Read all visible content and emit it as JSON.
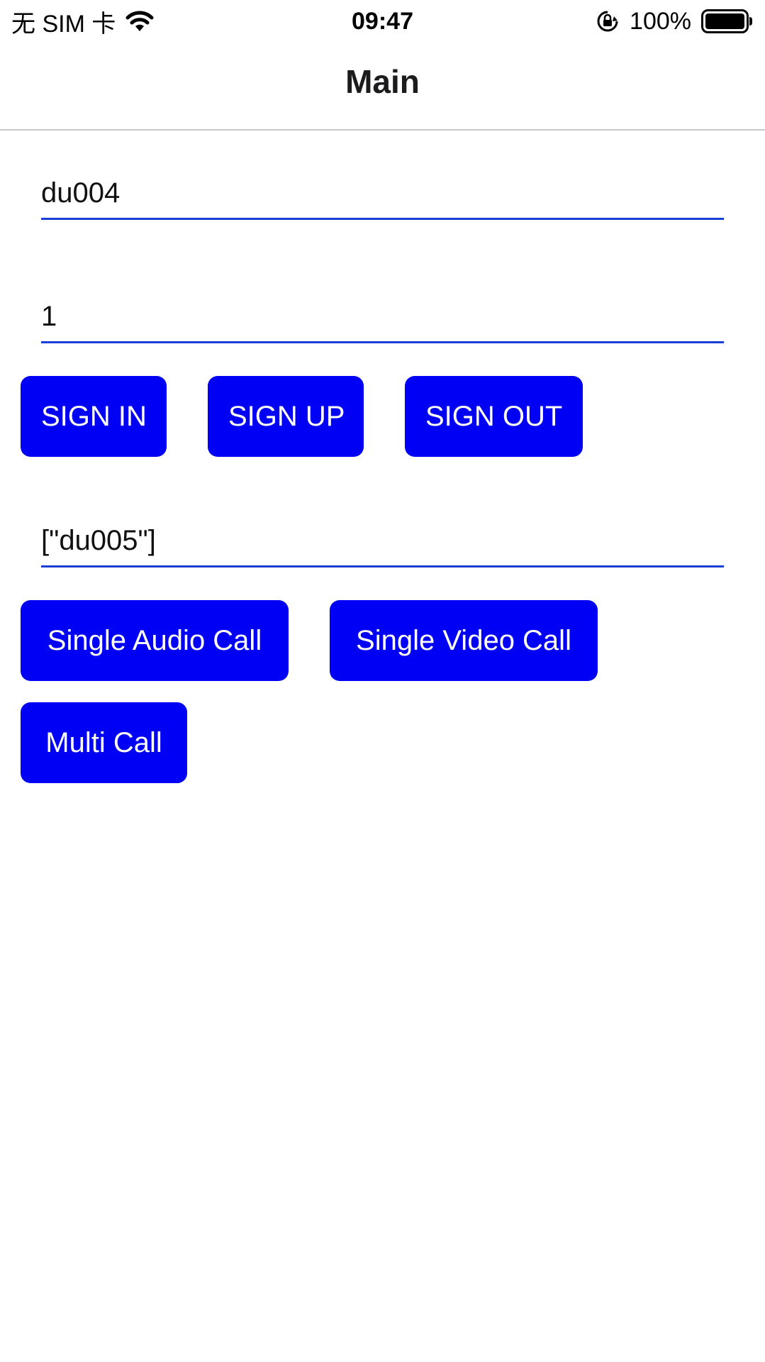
{
  "status_bar": {
    "carrier": "无 SIM 卡",
    "time": "09:47",
    "battery_percent": "100%",
    "icons": [
      "wifi-icon",
      "rotation-lock-icon",
      "battery-icon"
    ]
  },
  "nav": {
    "title": "Main"
  },
  "form": {
    "username_value": "du004",
    "password_value": "1",
    "callee_value": "[\"du005\"]"
  },
  "auth_buttons": {
    "sign_in": "SIGN IN",
    "sign_up": "SIGN UP",
    "sign_out": "SIGN OUT"
  },
  "call_buttons": {
    "single_audio": "Single Audio Call",
    "single_video": "Single Video Call",
    "multi": "Multi Call"
  },
  "colors": {
    "button_bg": "#0000f5",
    "button_text": "#ffffff",
    "input_underline": "#1a3fd6"
  }
}
